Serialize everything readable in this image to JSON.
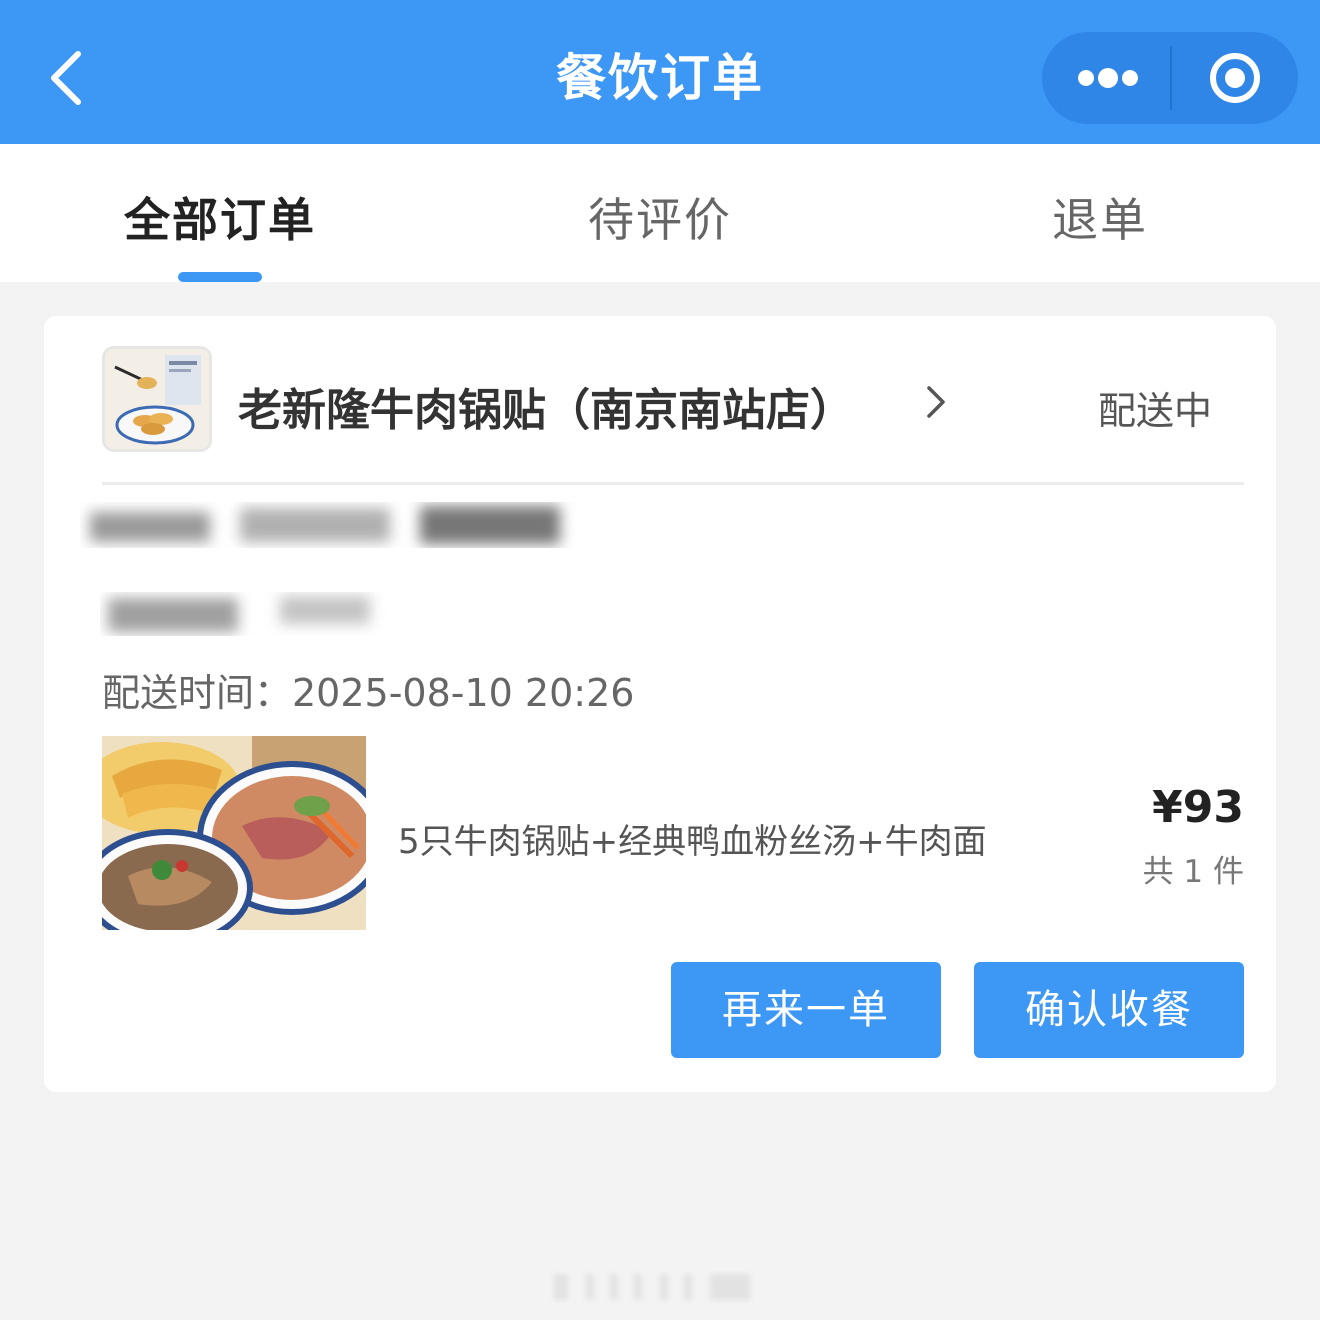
{
  "nav": {
    "title": "餐饮订单"
  },
  "tabs": [
    {
      "label": "全部订单",
      "active": true
    },
    {
      "label": "待评价",
      "active": false
    },
    {
      "label": "退单",
      "active": false
    }
  ],
  "order": {
    "shop_name": "老新隆牛肉锅贴（南京南站店）",
    "status": "配送中",
    "delivery_time": "配送时间：2025-08-10 20:26",
    "item_description": "5只牛肉锅贴+经典鸭血粉丝汤+牛肉面",
    "price": "¥93",
    "quantity": "共 1 件",
    "buttons": {
      "reorder": "再来一单",
      "confirm": "确认收餐"
    }
  },
  "colors": {
    "primary": "#3d97f5",
    "background": "#f3f3f3"
  },
  "icons": [
    "back-icon",
    "more-icon",
    "target-icon",
    "chevron-right-icon"
  ]
}
